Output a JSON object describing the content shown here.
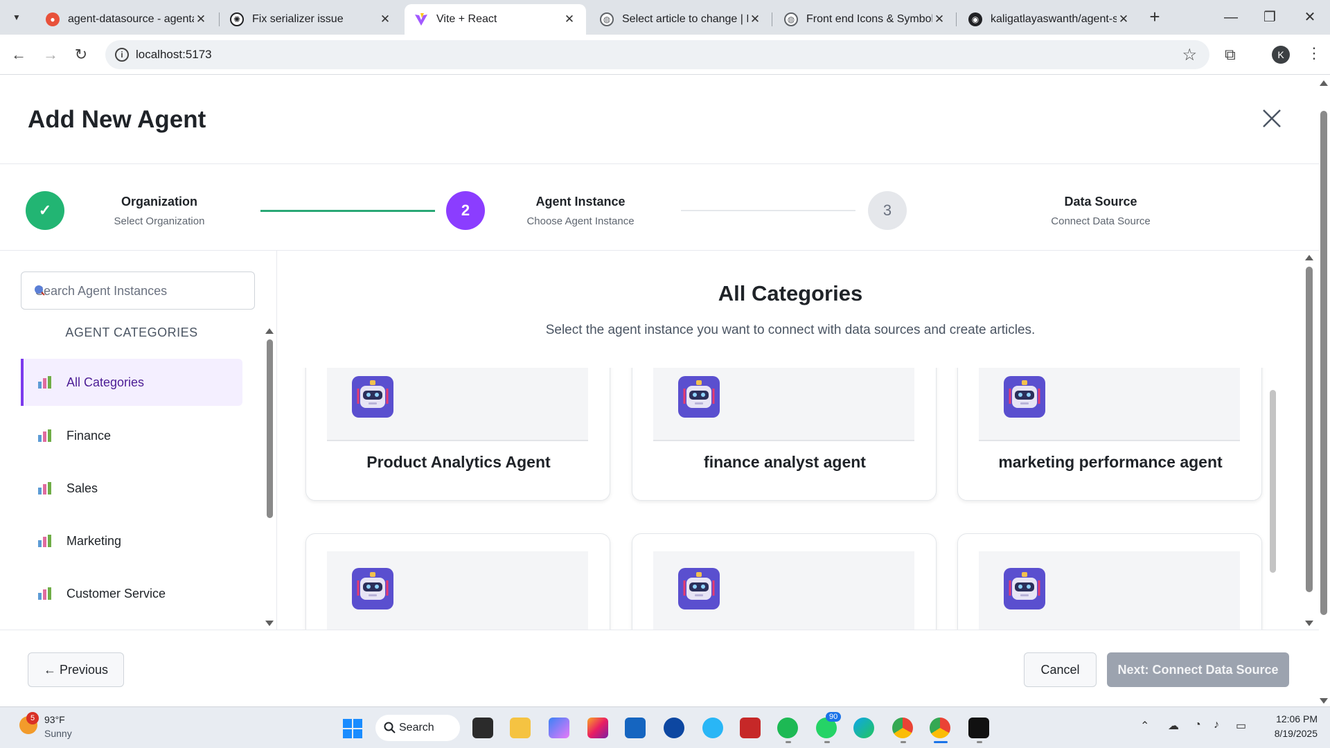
{
  "browser": {
    "tabs": [
      {
        "title": "agent-datasource - agenta",
        "favicon_color": "#e8513a",
        "active": false
      },
      {
        "title": "Fix serializer issue",
        "favicon_color": "#202124",
        "active": false
      },
      {
        "title": "Vite + React",
        "favicon_color": "#a259ff",
        "active": true
      },
      {
        "title": "Select article to change | D",
        "favicon_color": "#5f6368",
        "active": false
      },
      {
        "title": "Front end Icons & Symbols",
        "favicon_color": "#5f6368",
        "active": false
      },
      {
        "title": "kaligatlayaswanth/agent-s",
        "favicon_color": "#202124",
        "active": false
      }
    ],
    "url": "localhost:5173",
    "profile_initial": "K"
  },
  "modal": {
    "title": "Add New Agent",
    "steps": [
      {
        "number": "✓",
        "title": "Organization",
        "subtitle": "Select Organization",
        "state": "complete"
      },
      {
        "number": "2",
        "title": "Agent Instance",
        "subtitle": "Choose Agent Instance",
        "state": "active"
      },
      {
        "number": "3",
        "title": "Data Source",
        "subtitle": "Connect Data Source",
        "state": "pending"
      }
    ],
    "search_placeholder": "Search Agent Instances",
    "categories_heading": "AGENT CATEGORIES",
    "categories": [
      {
        "label": "All Categories",
        "active": true
      },
      {
        "label": "Finance",
        "active": false
      },
      {
        "label": "Sales",
        "active": false
      },
      {
        "label": "Marketing",
        "active": false
      },
      {
        "label": "Customer Service",
        "active": false
      }
    ],
    "content_title": "All Categories",
    "content_subtitle": "Select the agent instance you want to connect with data sources and create articles.",
    "agents": [
      {
        "name": "Product Analytics Agent"
      },
      {
        "name": "finance analyst agent"
      },
      {
        "name": "marketing performance agent"
      },
      {
        "name": ""
      },
      {
        "name": ""
      },
      {
        "name": ""
      }
    ],
    "footer": {
      "previous_label": "← Previous",
      "cancel_label": "Cancel",
      "next_label": "Next: Connect Data Source"
    }
  },
  "colors": {
    "accent": "#7c3aed",
    "complete": "#22b573",
    "disabled_button": "#9ca3af"
  },
  "taskbar": {
    "weather_badge": "5",
    "weather_temp": "93°F",
    "weather_condition": "Sunny",
    "search_label": "Search",
    "whatsapp_badge": "90",
    "time": "12:06 PM",
    "date": "8/19/2025"
  }
}
